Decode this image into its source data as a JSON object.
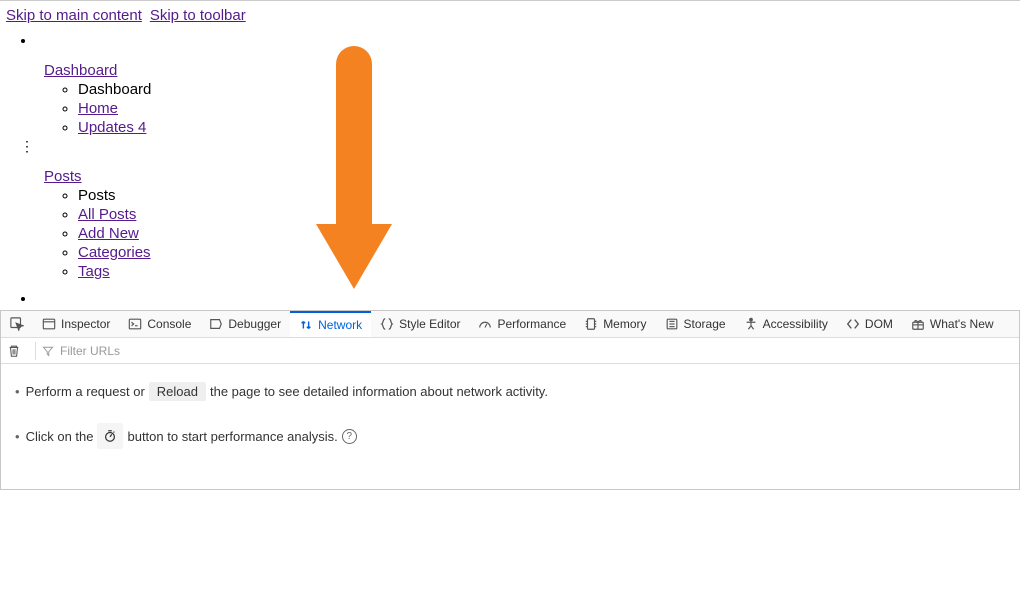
{
  "skip": {
    "main": "Skip to main content",
    "toolbar": "Skip to toolbar"
  },
  "menu": {
    "dashboard": {
      "label": "Dashboard",
      "items": [
        {
          "label": "Dashboard",
          "link": false
        },
        {
          "label": "Home",
          "link": true
        },
        {
          "label": "Updates 4",
          "link": true
        }
      ]
    },
    "posts": {
      "label": "Posts",
      "items": [
        {
          "label": "Posts",
          "link": false
        },
        {
          "label": "All Posts",
          "link": true
        },
        {
          "label": "Add New",
          "link": true
        },
        {
          "label": "Categories",
          "link": true
        },
        {
          "label": "Tags",
          "link": true
        }
      ]
    }
  },
  "devtools": {
    "tabs": {
      "inspector": "Inspector",
      "console": "Console",
      "debugger": "Debugger",
      "network": "Network",
      "styleeditor": "Style Editor",
      "performance": "Performance",
      "memory": "Memory",
      "storage": "Storage",
      "accessibility": "Accessibility",
      "dom": "DOM",
      "whatsnew": "What's New"
    },
    "filter_placeholder": "Filter URLs",
    "hints": {
      "p1a": "Perform a request or",
      "reload": "Reload",
      "p1b": "the page to see detailed information about network activity.",
      "p2a": "Click on the",
      "p2b": "button to start performance analysis."
    }
  }
}
